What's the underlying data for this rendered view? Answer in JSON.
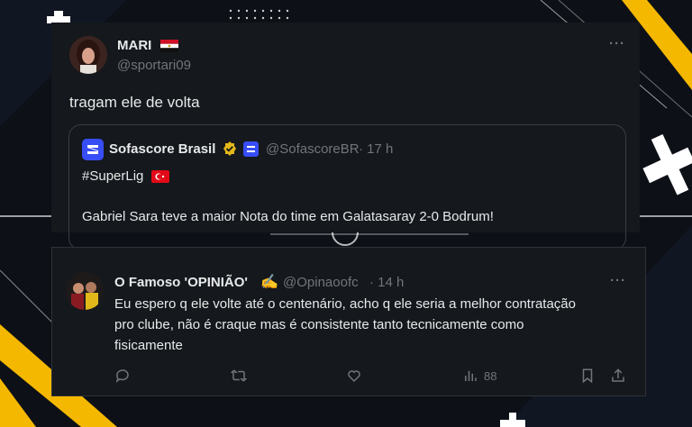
{
  "tweet": {
    "author_name": "MARI",
    "author_handle": "@sportari09",
    "text": "tragam ele de volta",
    "more": "···",
    "quoted": {
      "author_name": "Sofascore Brasil",
      "author_handle": "@SofascoreBR",
      "time": "· 17 h",
      "hashtag": "#SuperLig",
      "text": "Gabriel Sara teve a maior Nota do time em Galatasaray 2-0 Bodrum!"
    }
  },
  "reply": {
    "author_name": "O Famoso 'OPINIÃO'",
    "emoji": "✍️",
    "author_handle": "@Opinaoofc",
    "time": "· 14 h",
    "more": "···",
    "text_lines": [
      "Eu espero q ele volte até o centenário, acho q ele seria a melhor contratação",
      "pro clube, não é craque mas é consistente tanto tecnicamente como",
      "fisicamente"
    ],
    "actions": {
      "reply_icon": "comment-icon",
      "retweet_icon": "retweet-icon",
      "like_icon": "heart-icon",
      "views_icon": "views-icon",
      "views_count": "88",
      "bookmark_icon": "bookmark-icon",
      "share_icon": "share-icon"
    }
  },
  "colors": {
    "card_bg": "#15181c",
    "muted": "#71767b",
    "accent_yellow": "#f5b800",
    "sofascore_blue": "#374df5",
    "verified_gold": "#e2b719"
  }
}
